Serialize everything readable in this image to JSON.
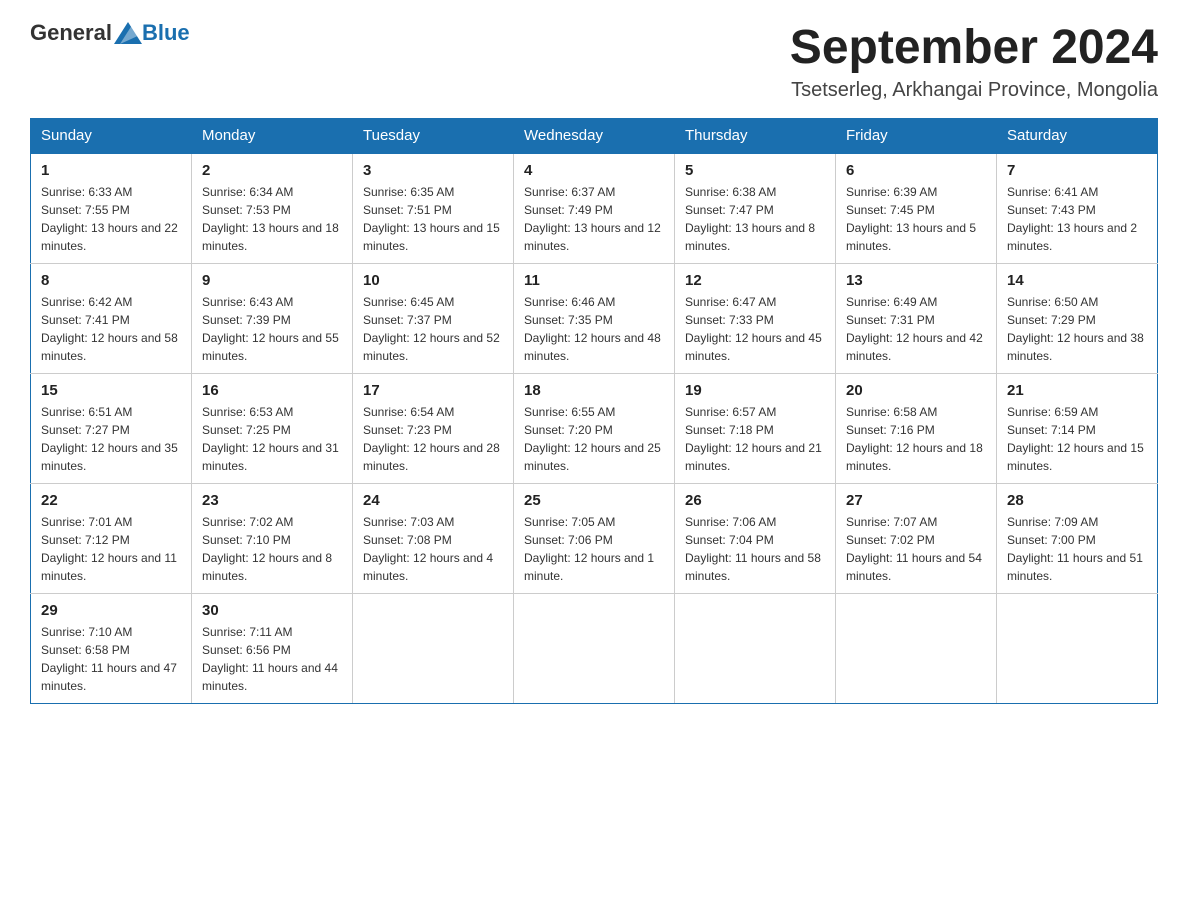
{
  "header": {
    "logo_general": "General",
    "logo_blue": "Blue",
    "month_title": "September 2024",
    "subtitle": "Tsetserleg, Arkhangai Province, Mongolia"
  },
  "days_of_week": [
    "Sunday",
    "Monday",
    "Tuesday",
    "Wednesday",
    "Thursday",
    "Friday",
    "Saturday"
  ],
  "weeks": [
    [
      {
        "day": "1",
        "sunrise": "6:33 AM",
        "sunset": "7:55 PM",
        "daylight": "13 hours and 22 minutes."
      },
      {
        "day": "2",
        "sunrise": "6:34 AM",
        "sunset": "7:53 PM",
        "daylight": "13 hours and 18 minutes."
      },
      {
        "day": "3",
        "sunrise": "6:35 AM",
        "sunset": "7:51 PM",
        "daylight": "13 hours and 15 minutes."
      },
      {
        "day": "4",
        "sunrise": "6:37 AM",
        "sunset": "7:49 PM",
        "daylight": "13 hours and 12 minutes."
      },
      {
        "day": "5",
        "sunrise": "6:38 AM",
        "sunset": "7:47 PM",
        "daylight": "13 hours and 8 minutes."
      },
      {
        "day": "6",
        "sunrise": "6:39 AM",
        "sunset": "7:45 PM",
        "daylight": "13 hours and 5 minutes."
      },
      {
        "day": "7",
        "sunrise": "6:41 AM",
        "sunset": "7:43 PM",
        "daylight": "13 hours and 2 minutes."
      }
    ],
    [
      {
        "day": "8",
        "sunrise": "6:42 AM",
        "sunset": "7:41 PM",
        "daylight": "12 hours and 58 minutes."
      },
      {
        "day": "9",
        "sunrise": "6:43 AM",
        "sunset": "7:39 PM",
        "daylight": "12 hours and 55 minutes."
      },
      {
        "day": "10",
        "sunrise": "6:45 AM",
        "sunset": "7:37 PM",
        "daylight": "12 hours and 52 minutes."
      },
      {
        "day": "11",
        "sunrise": "6:46 AM",
        "sunset": "7:35 PM",
        "daylight": "12 hours and 48 minutes."
      },
      {
        "day": "12",
        "sunrise": "6:47 AM",
        "sunset": "7:33 PM",
        "daylight": "12 hours and 45 minutes."
      },
      {
        "day": "13",
        "sunrise": "6:49 AM",
        "sunset": "7:31 PM",
        "daylight": "12 hours and 42 minutes."
      },
      {
        "day": "14",
        "sunrise": "6:50 AM",
        "sunset": "7:29 PM",
        "daylight": "12 hours and 38 minutes."
      }
    ],
    [
      {
        "day": "15",
        "sunrise": "6:51 AM",
        "sunset": "7:27 PM",
        "daylight": "12 hours and 35 minutes."
      },
      {
        "day": "16",
        "sunrise": "6:53 AM",
        "sunset": "7:25 PM",
        "daylight": "12 hours and 31 minutes."
      },
      {
        "day": "17",
        "sunrise": "6:54 AM",
        "sunset": "7:23 PM",
        "daylight": "12 hours and 28 minutes."
      },
      {
        "day": "18",
        "sunrise": "6:55 AM",
        "sunset": "7:20 PM",
        "daylight": "12 hours and 25 minutes."
      },
      {
        "day": "19",
        "sunrise": "6:57 AM",
        "sunset": "7:18 PM",
        "daylight": "12 hours and 21 minutes."
      },
      {
        "day": "20",
        "sunrise": "6:58 AM",
        "sunset": "7:16 PM",
        "daylight": "12 hours and 18 minutes."
      },
      {
        "day": "21",
        "sunrise": "6:59 AM",
        "sunset": "7:14 PM",
        "daylight": "12 hours and 15 minutes."
      }
    ],
    [
      {
        "day": "22",
        "sunrise": "7:01 AM",
        "sunset": "7:12 PM",
        "daylight": "12 hours and 11 minutes."
      },
      {
        "day": "23",
        "sunrise": "7:02 AM",
        "sunset": "7:10 PM",
        "daylight": "12 hours and 8 minutes."
      },
      {
        "day": "24",
        "sunrise": "7:03 AM",
        "sunset": "7:08 PM",
        "daylight": "12 hours and 4 minutes."
      },
      {
        "day": "25",
        "sunrise": "7:05 AM",
        "sunset": "7:06 PM",
        "daylight": "12 hours and 1 minute."
      },
      {
        "day": "26",
        "sunrise": "7:06 AM",
        "sunset": "7:04 PM",
        "daylight": "11 hours and 58 minutes."
      },
      {
        "day": "27",
        "sunrise": "7:07 AM",
        "sunset": "7:02 PM",
        "daylight": "11 hours and 54 minutes."
      },
      {
        "day": "28",
        "sunrise": "7:09 AM",
        "sunset": "7:00 PM",
        "daylight": "11 hours and 51 minutes."
      }
    ],
    [
      {
        "day": "29",
        "sunrise": "7:10 AM",
        "sunset": "6:58 PM",
        "daylight": "11 hours and 47 minutes."
      },
      {
        "day": "30",
        "sunrise": "7:11 AM",
        "sunset": "6:56 PM",
        "daylight": "11 hours and 44 minutes."
      },
      null,
      null,
      null,
      null,
      null
    ]
  ]
}
